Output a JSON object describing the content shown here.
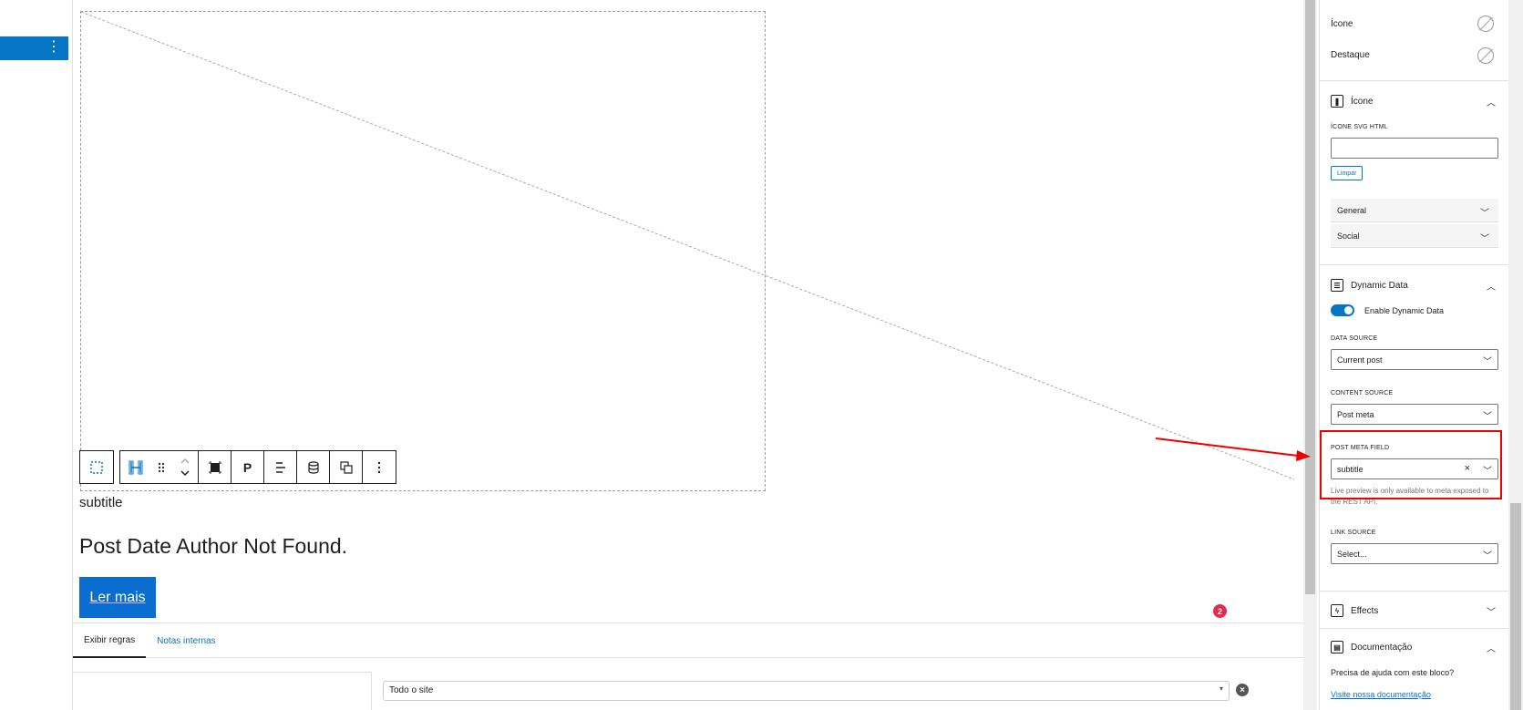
{
  "left_sidebar": {
    "menu_icon": "⋮"
  },
  "canvas": {
    "subtitle": "subtitle",
    "heading": "Post Date Author Not Found.",
    "read_more": "Ler mais",
    "notification_count": "2",
    "toolbar": {
      "paragraph_label": "P",
      "icons": [
        "select-parent-icon",
        "heading-block-icon",
        "drag-handle-icon",
        "move-updown-icon",
        "block-type-icon",
        "align-icon",
        "dynamic-data-icon",
        "duplicate-icon",
        "more-options-icon"
      ]
    }
  },
  "bottom_panel": {
    "tabs": [
      {
        "label": "Exibir regras",
        "active": true
      },
      {
        "label": "Notas internas",
        "active": false
      }
    ],
    "rule_select_value": "Todo o site"
  },
  "sidebar": {
    "icon_label": "Ícone",
    "highlight_label": "Destaque",
    "icon_panel": {
      "title": "Ícone",
      "svg_html_label": "ÍCONE SVG HTML",
      "svg_html_value": "",
      "clear_button": "Limpar",
      "groups": [
        "General",
        "Social"
      ]
    },
    "dynamic_data": {
      "title": "Dynamic Data",
      "enable_label": "Enable Dynamic Data",
      "enabled": true,
      "data_source_label": "DATA SOURCE",
      "data_source_value": "Current post",
      "content_source_label": "CONTENT SOURCE",
      "content_source_value": "Post meta",
      "post_meta_field_label": "POST META FIELD",
      "post_meta_field_value": "subtitle",
      "hint": "Live preview is only available to meta exposed to the REST API.",
      "link_source_label": "LINK SOURCE",
      "link_source_value": "Select..."
    },
    "effects_title": "Effects",
    "documentation": {
      "title": "Documentação",
      "help_text": "Precisa de ajuda com este bloco?",
      "link": "Visite nossa documentação"
    }
  },
  "colors": {
    "accent": "#0675c4",
    "button_bg": "#0a6ed1",
    "highlight_border": "#ee0000",
    "badge": "#e32a52"
  }
}
